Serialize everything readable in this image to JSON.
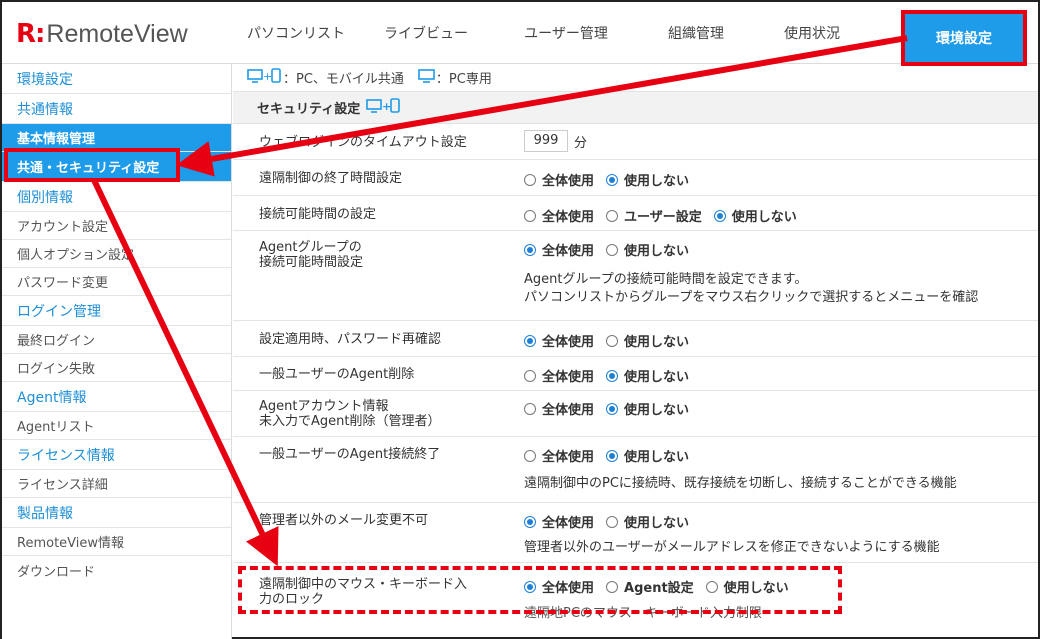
{
  "logo": {
    "mark": "R:",
    "text": "RemoteView"
  },
  "nav": {
    "items": [
      "パソコンリスト",
      "ライブビュー",
      "ユーザー管理",
      "組織管理",
      "使用状況"
    ],
    "active": "環境設定"
  },
  "sidebar": {
    "items": [
      {
        "label": "環境設定",
        "kind": "head"
      },
      {
        "label": "共通情報",
        "kind": "head"
      },
      {
        "label": "基本情報管理",
        "kind": "active-parent"
      },
      {
        "label": "共通・セキュリティ設定",
        "kind": "active"
      },
      {
        "label": "個別情報",
        "kind": "head"
      },
      {
        "label": "アカウント設定",
        "kind": "sub"
      },
      {
        "label": "個人オプション設定",
        "kind": "sub"
      },
      {
        "label": "パスワード変更",
        "kind": "sub"
      },
      {
        "label": "ログイン管理",
        "kind": "head"
      },
      {
        "label": "最終ログイン",
        "kind": "sub"
      },
      {
        "label": "ログイン失敗",
        "kind": "sub"
      },
      {
        "label": "Agent情報",
        "kind": "head"
      },
      {
        "label": "Agentリスト",
        "kind": "sub"
      },
      {
        "label": "ライセンス情報",
        "kind": "head"
      },
      {
        "label": "ライセンス詳細",
        "kind": "sub"
      },
      {
        "label": "製品情報",
        "kind": "head"
      },
      {
        "label": "RemoteView情報",
        "kind": "sub"
      },
      {
        "label": "ダウンロード",
        "kind": "sub"
      }
    ]
  },
  "legend": {
    "common": "：PC、モバイル共通",
    "pc_only": "：PC専用"
  },
  "section": {
    "title": "セキュリティ設定"
  },
  "rows": {
    "timeout": {
      "label": "ウェブログインのタイムアウト設定",
      "value": "999",
      "unit": "分"
    },
    "remote_end": {
      "label": "遠隔制御の終了時間設定",
      "options": [
        "全体使用",
        "使用しない"
      ],
      "selected": 1
    },
    "conn_time": {
      "label": "接続可能時間の設定",
      "options": [
        "全体使用",
        "ユーザー設定",
        "使用しない"
      ],
      "selected": 2
    },
    "agent_group": {
      "label1": "Agentグループの",
      "label2": "接続可能時間設定",
      "options": [
        "全体使用",
        "使用しない"
      ],
      "selected": 0,
      "desc1": "Agentグループの接続可能時間を設定できます。",
      "desc2": "パソコンリストからグループをマウス右クリックで選択するとメニューを確認"
    },
    "pw_confirm": {
      "label": "設定適用時、パスワード再確認",
      "options": [
        "全体使用",
        "使用しない"
      ],
      "selected": 0
    },
    "agent_delete": {
      "label": "一般ユーザーのAgent削除",
      "options": [
        "全体使用",
        "使用しない"
      ],
      "selected": 1
    },
    "agent_account": {
      "label1": "Agentアカウント情報",
      "label2": "未入力でAgent削除（管理者）",
      "options": [
        "全体使用",
        "使用しない"
      ],
      "selected": 1
    },
    "agent_end": {
      "label": "一般ユーザーのAgent接続終了",
      "options": [
        "全体使用",
        "使用しない"
      ],
      "selected": 1,
      "desc": "遠隔制御中のPCに接続時、既存接続を切断し、接続することができる機能"
    },
    "mail": {
      "label": "管理者以外のメール変更不可",
      "options": [
        "全体使用",
        "使用しない"
      ],
      "selected": 0,
      "desc": "管理者以外のユーザーがメールアドレスを修正できないようにする機能"
    },
    "lock": {
      "label1": "遠隔制御中のマウス・キーボード入",
      "label2": "力のロック",
      "options": [
        "全体使用",
        "Agent設定",
        "使用しない"
      ],
      "selected": 0,
      "desc": "遠隔地PCのマウス・キーボード入力制限"
    }
  },
  "colors": {
    "accent": "#1e9be9",
    "annotation": "#e60012"
  }
}
